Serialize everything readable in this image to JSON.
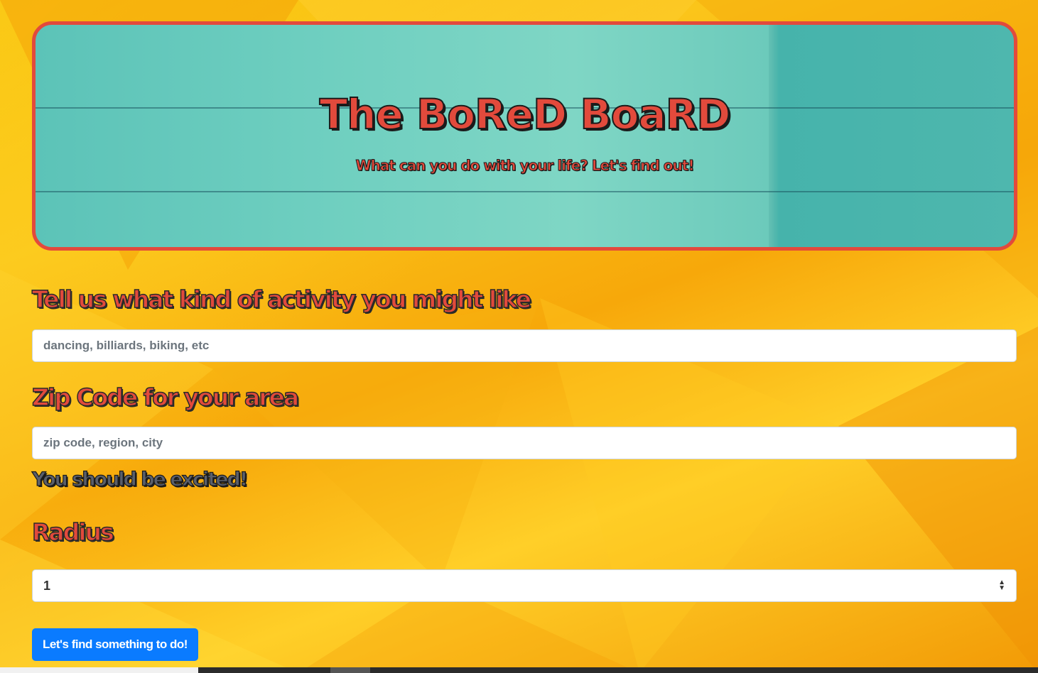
{
  "hero": {
    "title": "The BoReD BoaRD",
    "subtitle": "What can you do with your life? Let's find out!"
  },
  "form": {
    "activity_label": "Tell us what kind of activity you might like",
    "activity_placeholder": "dancing, billiards, biking, etc",
    "zip_label": "Zip Code for your area",
    "zip_placeholder": "zip code, region, city",
    "hint": "You should be excited!",
    "radius_label": "Radius",
    "radius_value": "1",
    "submit_label": "Let's find something to do!"
  },
  "colors": {
    "accent_red": "#e24a3c",
    "button_blue": "#0a7bff",
    "background_yellow": "#fbc51a",
    "hero_teal": "#6fcfc0"
  }
}
